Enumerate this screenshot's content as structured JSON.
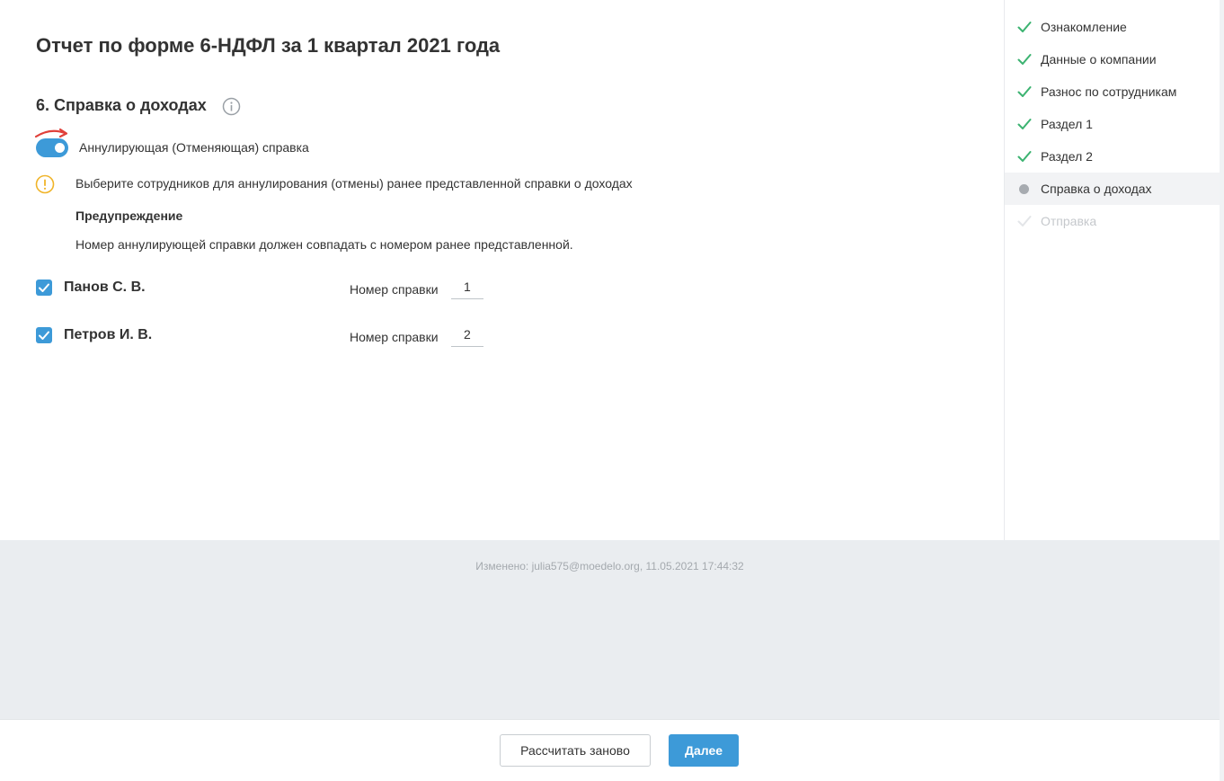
{
  "page_title": "Отчет по форме 6-НДФЛ за 1 квартал 2021 года",
  "section": {
    "title": "6. Справка о доходах",
    "toggle": {
      "label": "Аннулирующая (Отменяющая) справка",
      "checked": true
    }
  },
  "notice": {
    "text": "Выберите сотрудников для аннулирования (отмены) ранее представленной справки о доходах",
    "heading": "Предупреждение",
    "body": "Номер аннулирующей справки должен совпадать с номером ранее представленной."
  },
  "employees": [
    {
      "name": "Панов С. В.",
      "checked": true,
      "number_label": "Номер справки",
      "number": "1"
    },
    {
      "name": "Петров И. В.",
      "checked": true,
      "number_label": "Номер справки",
      "number": "2"
    }
  ],
  "steps": [
    {
      "label": "Ознакомление",
      "status": "done"
    },
    {
      "label": "Данные о компании",
      "status": "done"
    },
    {
      "label": "Разнос по сотрудникам",
      "status": "done"
    },
    {
      "label": "Раздел 1",
      "status": "done"
    },
    {
      "label": "Раздел 2",
      "status": "done"
    },
    {
      "label": "Справка о доходах",
      "status": "current"
    },
    {
      "label": "Отправка",
      "status": "disabled"
    }
  ],
  "changed_text": "Изменено: julia575@moedelo.org, 11.05.2021 17:44:32",
  "buttons": {
    "recalc": "Рассчитать заново",
    "next": "Далее"
  },
  "colors": {
    "accent": "#3d9ad8",
    "check": "#3cb371",
    "warning": "#f0b429",
    "arrow": "#e0403a"
  }
}
